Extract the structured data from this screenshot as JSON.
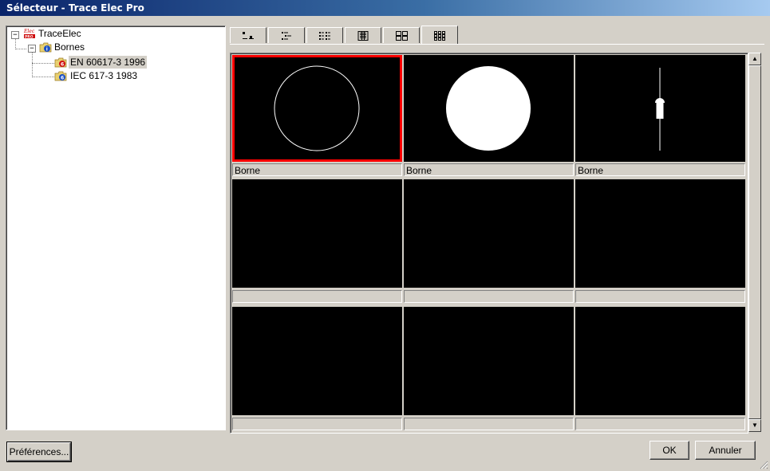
{
  "window": {
    "title": "Sélecteur - Trace Elec Pro"
  },
  "tree": {
    "root": {
      "label": "TraceElec",
      "icon": "elec-pro-logo-icon"
    },
    "group": {
      "label": "Bornes",
      "icon": "folder-info-icon"
    },
    "items": [
      {
        "label": "EN 60617-3 1996",
        "icon": "library-red-icon",
        "selected": true
      },
      {
        "label": "IEC 617-3 1983",
        "icon": "library-blue-icon",
        "selected": false
      }
    ]
  },
  "view_tabs": [
    {
      "name": "view-large-list-icon"
    },
    {
      "name": "view-tree-list-icon"
    },
    {
      "name": "view-detail-list-icon"
    },
    {
      "name": "view-columns-icon"
    },
    {
      "name": "view-large-icons-icon"
    },
    {
      "name": "view-small-icons-icon",
      "active": true
    }
  ],
  "grid": {
    "rows": [
      [
        {
          "symbol": "circle-outline",
          "caption": "Borne",
          "selected": true
        },
        {
          "symbol": "circle-filled",
          "caption": "Borne"
        },
        {
          "symbol": "fuse-terminal",
          "caption": "Borne"
        }
      ],
      [
        {
          "symbol": "",
          "caption": ""
        },
        {
          "symbol": "",
          "caption": ""
        },
        {
          "symbol": "",
          "caption": ""
        }
      ],
      [
        {
          "symbol": "",
          "caption": ""
        },
        {
          "symbol": "",
          "caption": ""
        },
        {
          "symbol": "",
          "caption": ""
        }
      ]
    ]
  },
  "footer": {
    "preferences_label": "Préférences...",
    "ok_label": "OK",
    "cancel_label": "Annuler"
  },
  "colors": {
    "titlebar_start": "#0a246a",
    "titlebar_end": "#a6caf0",
    "selection_border": "#ff0000",
    "preview_background": "#000000"
  }
}
